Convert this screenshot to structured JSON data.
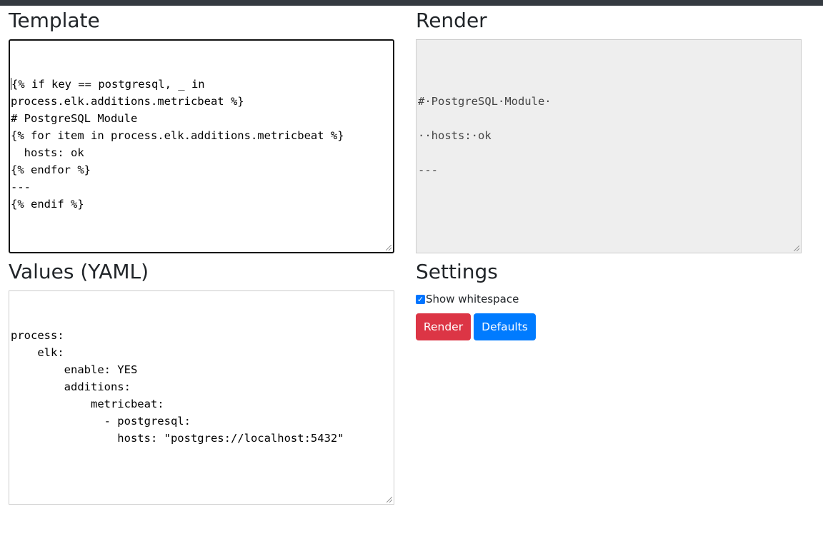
{
  "headings": {
    "template": "Template",
    "render": "Render",
    "values": "Values (YAML)",
    "settings": "Settings"
  },
  "template_lines": [
    "{% if key == postgresql, _ in",
    "process.elk.additions.metricbeat %}",
    "# PostgreSQL Module",
    "{% for item in process.elk.additions.metricbeat %}",
    "  hosts: ok",
    "{% endfor %}",
    "---",
    "{% endif %}"
  ],
  "render_lines": [
    "",
    "#·PostgreSQL·Module·",
    "",
    "··hosts:·ok",
    "",
    "---"
  ],
  "values_lines": [
    "process:",
    "    elk:",
    "        enable: YES",
    "        additions:",
    "            metricbeat:",
    "              - postgresql:",
    "                hosts: \"postgres://localhost:5432\""
  ],
  "settings": {
    "show_whitespace_label": "Show whitespace",
    "show_whitespace_checked": true
  },
  "buttons": {
    "render": "Render",
    "defaults": "Defaults"
  },
  "colors": {
    "render_button": "#dc3545",
    "defaults_button": "#007bff",
    "topbar": "#343a40"
  }
}
